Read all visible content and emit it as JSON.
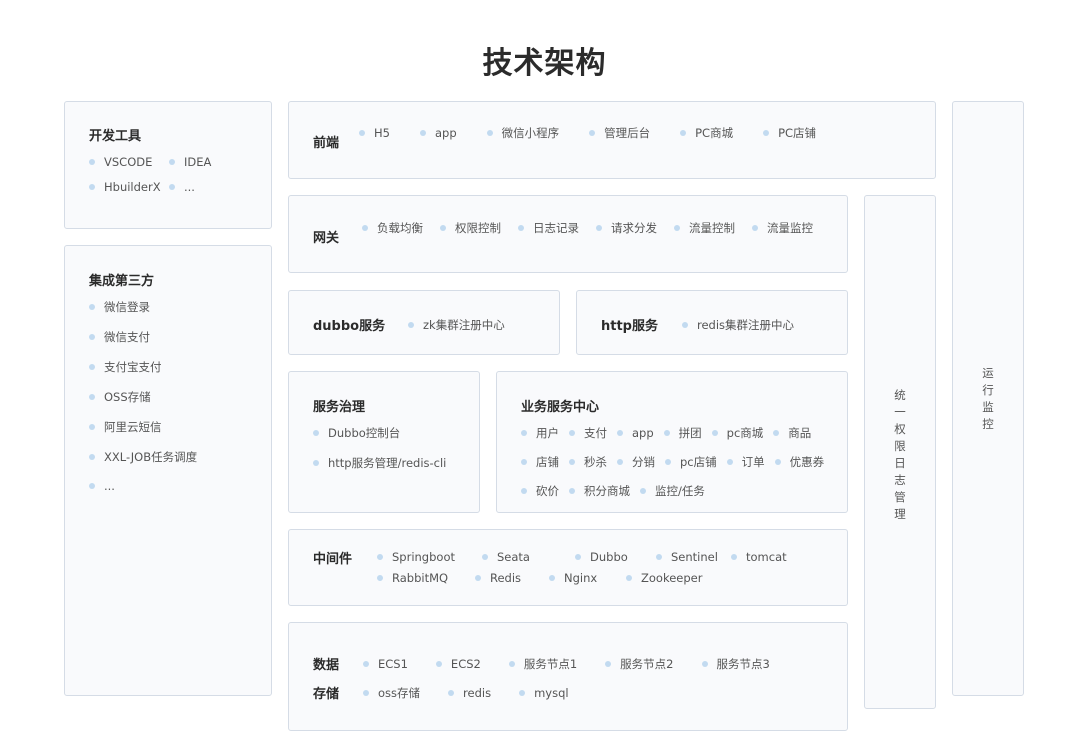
{
  "title": "技术架构",
  "dev_tools": {
    "title": "开发工具",
    "items": [
      "VSCODE",
      "IDEA",
      "HbuilderX",
      "..."
    ]
  },
  "third_party": {
    "title": "集成第三方",
    "items": [
      "微信登录",
      "微信支付",
      "支付宝支付",
      "OSS存储",
      "阿里云短信",
      "XXL-JOB任务调度",
      "..."
    ]
  },
  "frontend": {
    "title": "前端",
    "items": [
      "H5",
      "app",
      "微信小程序",
      "管理后台",
      "PC商城",
      "PC店铺"
    ]
  },
  "gateway": {
    "title": "网关",
    "items": [
      "负载均衡",
      "权限控制",
      "日志记录",
      "请求分发",
      "流量控制",
      "流量监控"
    ]
  },
  "dubbo": {
    "title": "dubbo服务",
    "items": [
      "zk集群注册中心"
    ]
  },
  "http": {
    "title": "http服务",
    "items": [
      "redis集群注册中心"
    ]
  },
  "governance": {
    "title": "服务治理",
    "items": [
      "Dubbo控制台",
      "http服务管理/redis-cli"
    ]
  },
  "business": {
    "title": "业务服务中心",
    "rows": [
      [
        "用户",
        "支付",
        "app",
        "拼团",
        "pc商城",
        "商品"
      ],
      [
        "店铺",
        "秒杀",
        "分销",
        "pc店铺",
        "订单",
        "优惠券"
      ],
      [
        "砍价",
        "积分商城",
        "监控/任务"
      ]
    ]
  },
  "middleware": {
    "title": "中间件",
    "rows": [
      [
        "Springboot",
        "Seata",
        "Dubbo",
        "Sentinel",
        "tomcat"
      ],
      [
        "RabbitMQ",
        "Redis",
        "Nginx",
        "Zookeeper"
      ]
    ]
  },
  "data": {
    "title": "数据",
    "items": [
      "ECS1",
      "ECS2",
      "服务节点1",
      "服务节点2",
      "服务节点3"
    ]
  },
  "storage": {
    "title": "存储",
    "items": [
      "oss存储",
      "redis",
      "mysql"
    ]
  },
  "auth": {
    "chars": [
      "统",
      "一",
      "权",
      "限",
      "日",
      "志",
      "管",
      "理"
    ]
  },
  "ops": {
    "chars": [
      "运",
      "行",
      "监",
      "控"
    ]
  }
}
